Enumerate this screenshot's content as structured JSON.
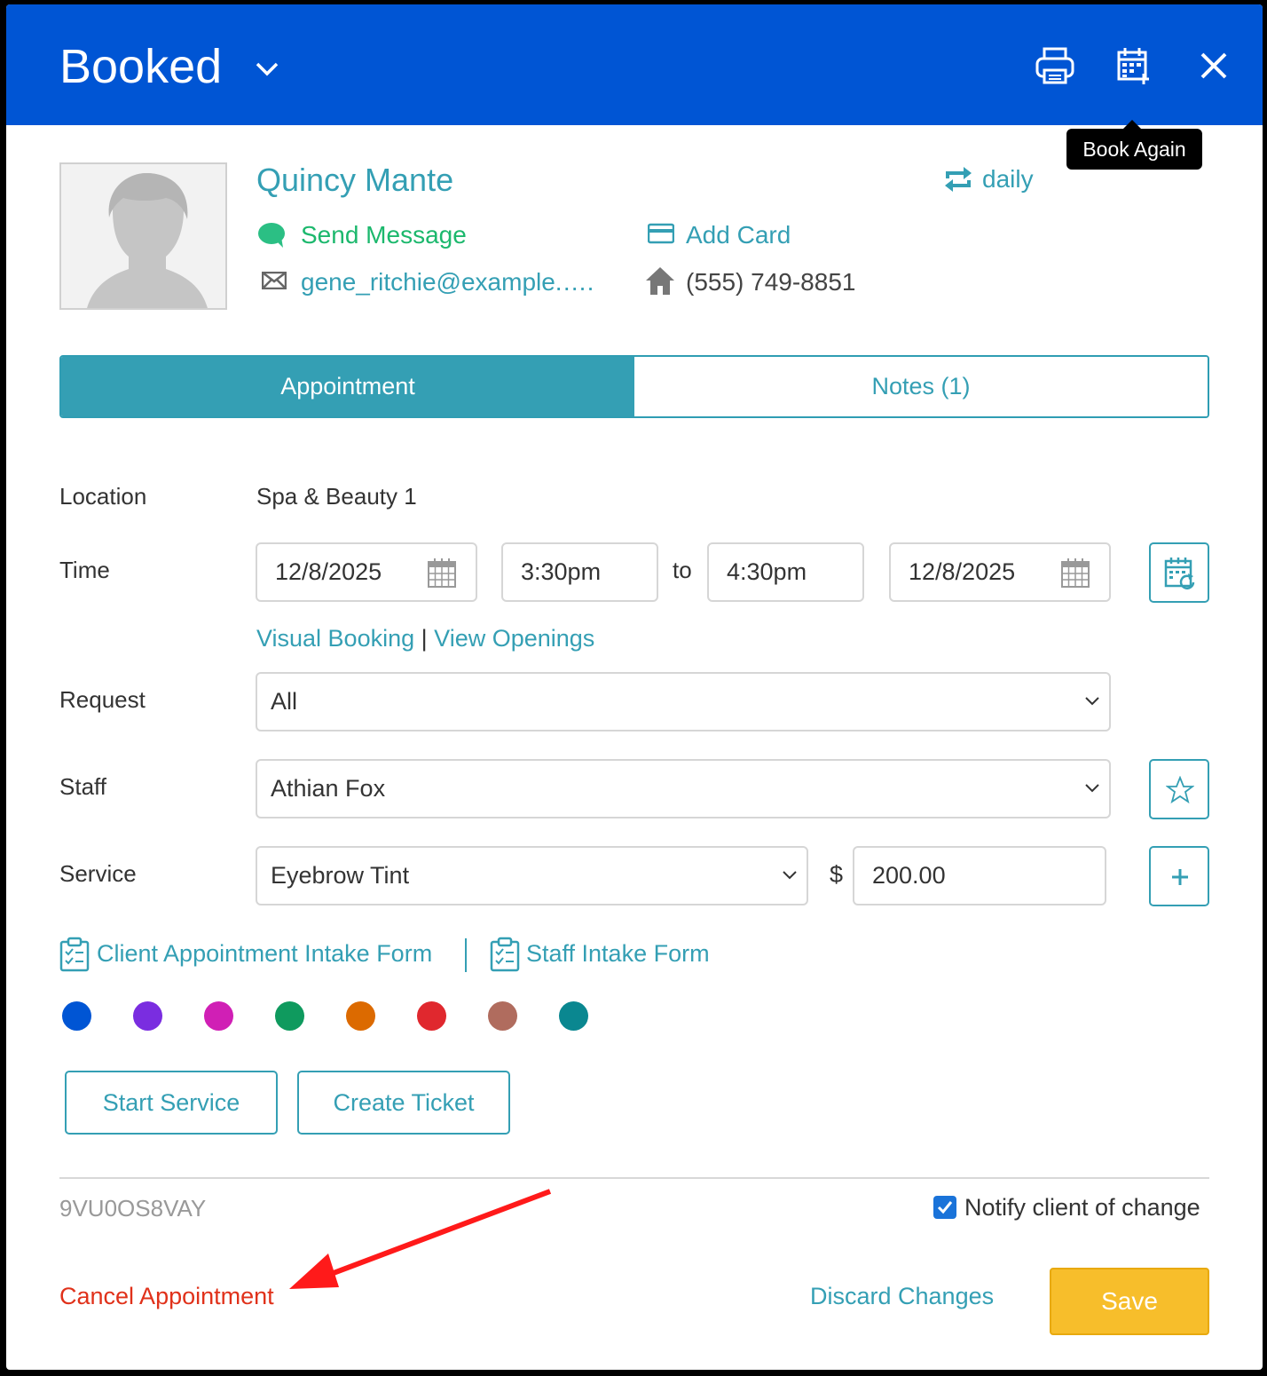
{
  "header": {
    "status_title": "Booked",
    "icons": [
      "printer-icon",
      "book-again-icon",
      "close-icon"
    ],
    "tooltip": "Book Again",
    "background": "#0055d4"
  },
  "client": {
    "name": "Quincy Mante",
    "recurrence": "daily",
    "send_message": "Send Message",
    "add_card": "Add Card",
    "email": "gene_ritchie@example.….",
    "phone": "(555) 749-8851"
  },
  "tabs": [
    {
      "label": "Appointment",
      "active": true
    },
    {
      "label": "Notes (1)",
      "active": false
    }
  ],
  "form": {
    "location_label": "Location",
    "location_value": "Spa & Beauty 1",
    "time_label": "Time",
    "start_date": "12/8/2025",
    "start_time": "3:30pm",
    "to_label": "to",
    "end_time": "4:30pm",
    "end_date": "12/8/2025",
    "visual_booking": "Visual Booking",
    "separator": "|",
    "view_openings": "View Openings",
    "request_label": "Request",
    "request_value": "All",
    "staff_label": "Staff",
    "staff_value": "Athian Fox",
    "service_label": "Service",
    "service_value": "Eyebrow Tint",
    "currency": "$",
    "price": "200.00"
  },
  "intake": {
    "client_form": "Client Appointment Intake Form",
    "staff_form": "Staff Intake Form"
  },
  "colors": [
    "#0055d4",
    "#7a2de0",
    "#d01fb5",
    "#0f9a5e",
    "#dc6a00",
    "#e0282e",
    "#b06c5e",
    "#0a8790"
  ],
  "actions": {
    "start_service": "Start Service",
    "create_ticket": "Create Ticket"
  },
  "footer": {
    "appointment_id": "9VU0OS8VAY",
    "notify_label": "Notify client of change",
    "notify_checked": true,
    "cancel": "Cancel Appointment",
    "discard": "Discard Changes",
    "save": "Save"
  },
  "accent": "#349fb4"
}
